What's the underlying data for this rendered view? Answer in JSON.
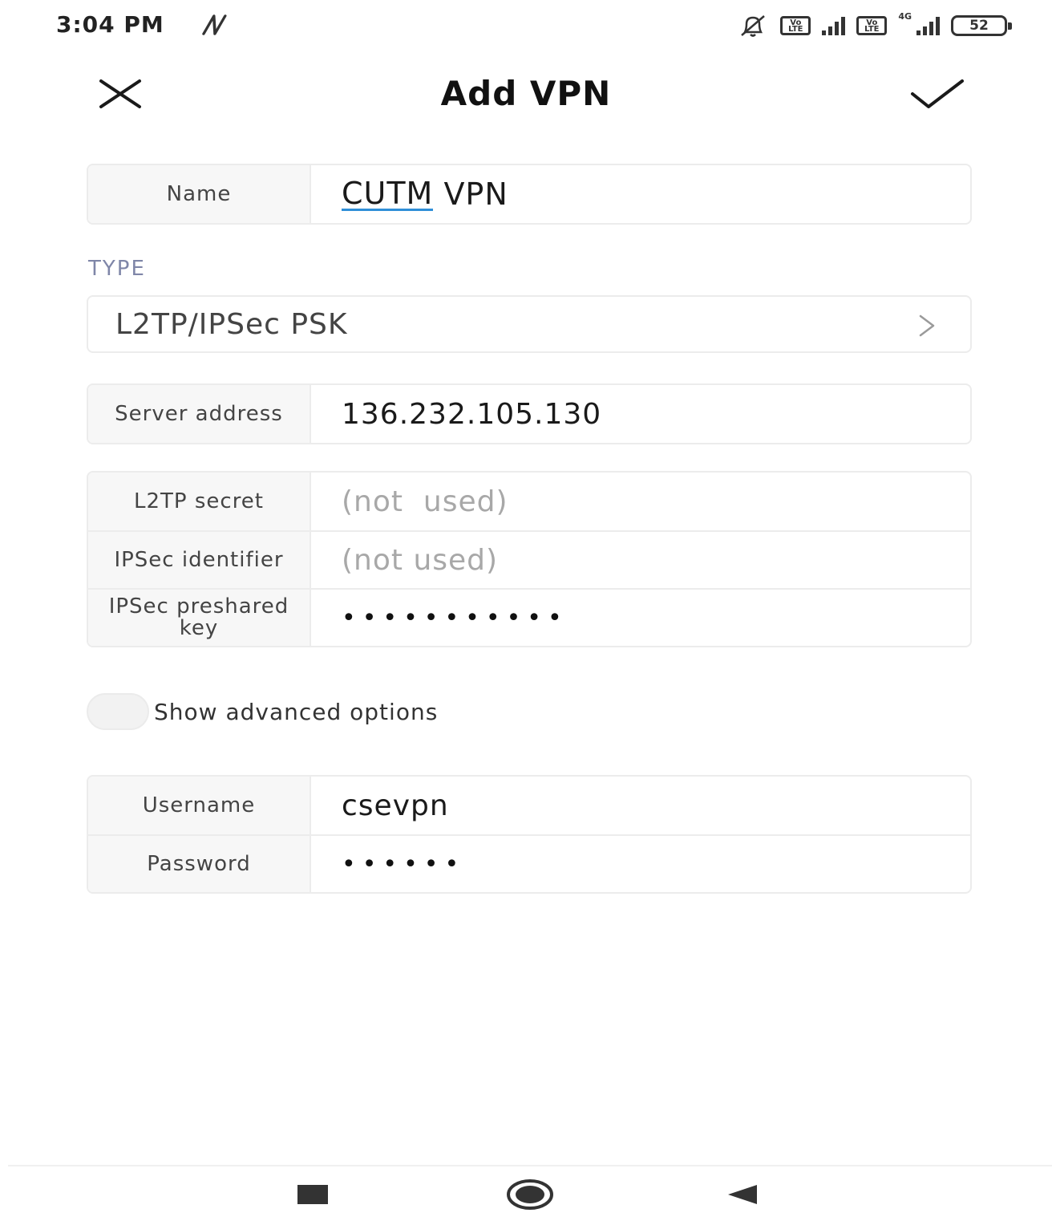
{
  "status_bar": {
    "time": "3:04 PM",
    "battery": "52",
    "network_type": "4G",
    "volte_label": "Vo LTE",
    "icons": [
      "nfc-icon",
      "mute-icon",
      "volte-icon",
      "signal-icon",
      "battery-icon"
    ]
  },
  "header": {
    "title": "Add VPN",
    "close_icon": "close-icon",
    "confirm_icon": "check-icon"
  },
  "name_field": {
    "label": "Name",
    "value_underlined": "CUTM",
    "value_rest": " VPN"
  },
  "type_section": {
    "label": "TYPE",
    "value": "L2TP/IPSec PSK"
  },
  "server_field": {
    "label": "Server address",
    "value": "136.232.105.130"
  },
  "ipsec_fields": [
    {
      "label": "L2TP secret",
      "value": "(not  used)",
      "is_placeholder": true
    },
    {
      "label": "IPSec identifier",
      "value": "(not used)",
      "is_placeholder": true
    },
    {
      "label": "IPSec preshared key",
      "value": "•••••••••••",
      "is_placeholder": false
    }
  ],
  "advanced_toggle": {
    "label": "Show advanced options",
    "enabled": false
  },
  "credentials": [
    {
      "label": "Username",
      "value": "csevpn"
    },
    {
      "label": "Password",
      "value": "••••••"
    }
  ],
  "colors": {
    "accent": "#2f8fd8",
    "section_label": "#7f86a8",
    "placeholder": "#a8a8a8"
  }
}
